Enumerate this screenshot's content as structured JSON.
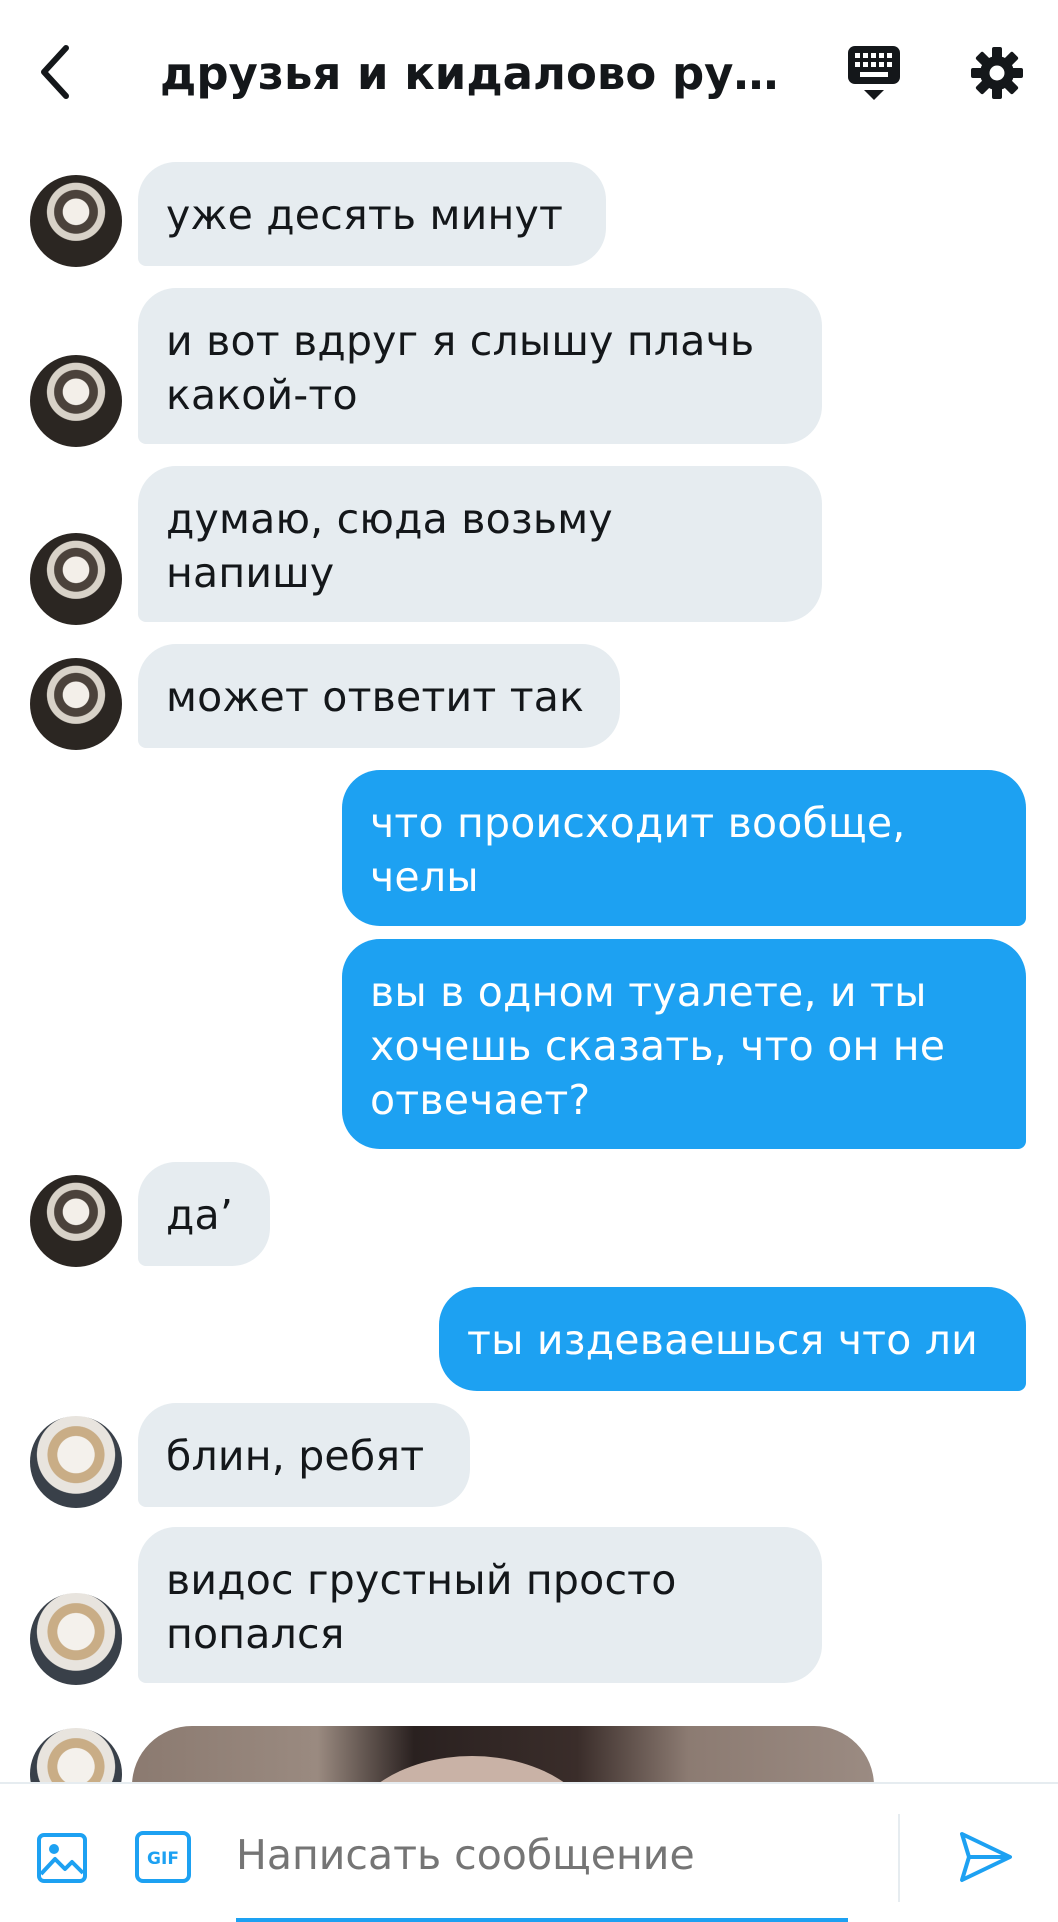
{
  "header": {
    "title": "друзья и кидалово рут..."
  },
  "messages": [
    {
      "dir": "in",
      "text": "уже десять минут"
    },
    {
      "dir": "in",
      "text": "и вот вдруг я слышу плачь какой-то"
    },
    {
      "dir": "in",
      "text": "думаю, сюда возьму напишу"
    },
    {
      "dir": "in",
      "text": "может ответит так"
    },
    {
      "dir": "out",
      "text": "что происходит вообще, челы"
    },
    {
      "dir": "out",
      "text": "вы в одном туалете, и ты хочешь сказать, что он не отвечает?"
    },
    {
      "dir": "in",
      "text": "да’"
    },
    {
      "dir": "out",
      "text": "ты издеваешься что ли"
    },
    {
      "dir": "in",
      "text": "блин, ребят"
    },
    {
      "dir": "in",
      "text": "видос грустный просто попался"
    }
  ],
  "composer": {
    "placeholder": "Написать сообщение",
    "gif_label": "GIF"
  },
  "colors": {
    "accent": "#1da1f2",
    "incoming_bubble": "#e6ecf0",
    "text": "#14171a"
  }
}
